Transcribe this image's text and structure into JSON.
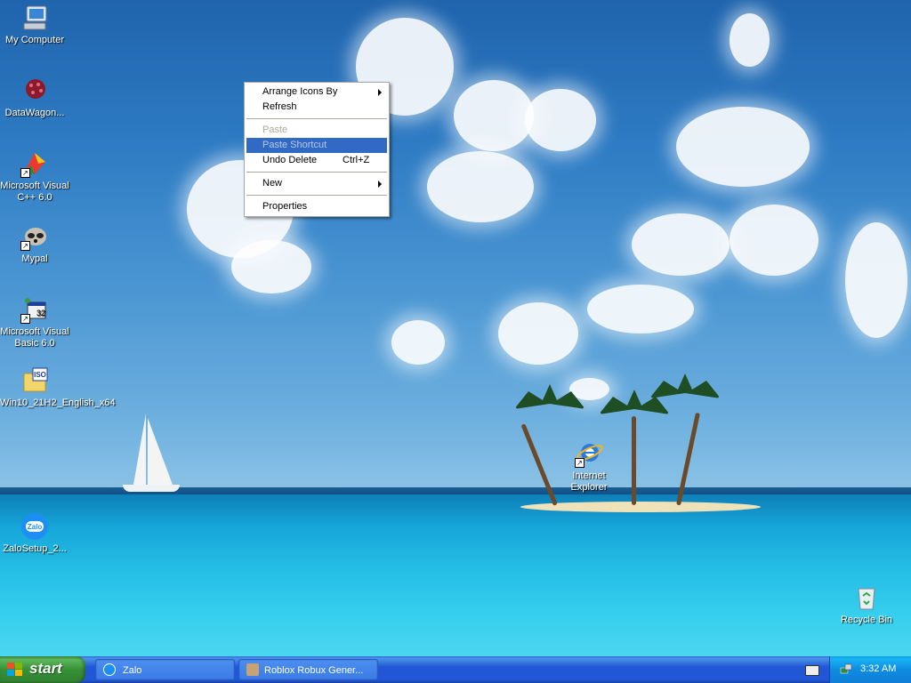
{
  "desktop": {
    "icons": [
      {
        "label": "My Computer",
        "icon": "my-computer-icon"
      },
      {
        "label": "DataWagon...",
        "icon": "datawagon-icon"
      },
      {
        "label": "Microsoft Visual C++ 6.0",
        "icon": "visual-cpp-icon"
      },
      {
        "label": "Mypal",
        "icon": "mypal-icon"
      },
      {
        "label": "Microsoft Visual Basic 6.0",
        "icon": "visual-basic-icon"
      },
      {
        "label": "Win10_21H2_English_x64",
        "icon": "iso-file-icon"
      },
      {
        "label": "ZaloSetup_2...",
        "icon": "zalo-setup-icon"
      },
      {
        "label": "Internet Explorer",
        "icon": "internet-explorer-icon"
      },
      {
        "label": "Recycle Bin",
        "icon": "recycle-bin-icon"
      }
    ],
    "iso_badge": "ISO",
    "zalo_badge": "Zalo"
  },
  "context_menu": {
    "items": [
      {
        "label": "Arrange Icons By",
        "submenu": true,
        "enabled": true
      },
      {
        "label": "Refresh",
        "enabled": true
      },
      {
        "label": "Paste",
        "enabled": false
      },
      {
        "label": "Paste Shortcut",
        "enabled": false,
        "highlighted": true
      },
      {
        "label": "Undo Delete",
        "accelerator": "Ctrl+Z",
        "enabled": true
      },
      {
        "label": "New",
        "submenu": true,
        "enabled": true
      },
      {
        "label": "Properties",
        "enabled": true
      }
    ]
  },
  "taskbar": {
    "start_label": "start",
    "tasks": [
      {
        "label": "Zalo",
        "icon": "zalo-icon"
      },
      {
        "label": "Roblox Robux Gener...",
        "icon": "roblox-icon"
      }
    ],
    "tray": {
      "clock": "3:32 AM"
    }
  },
  "colors": {
    "taskbar_blue": "#2157d7",
    "start_green": "#379137",
    "menu_highlight": "#316ac5",
    "tray_blue": "#0e8ce0"
  }
}
